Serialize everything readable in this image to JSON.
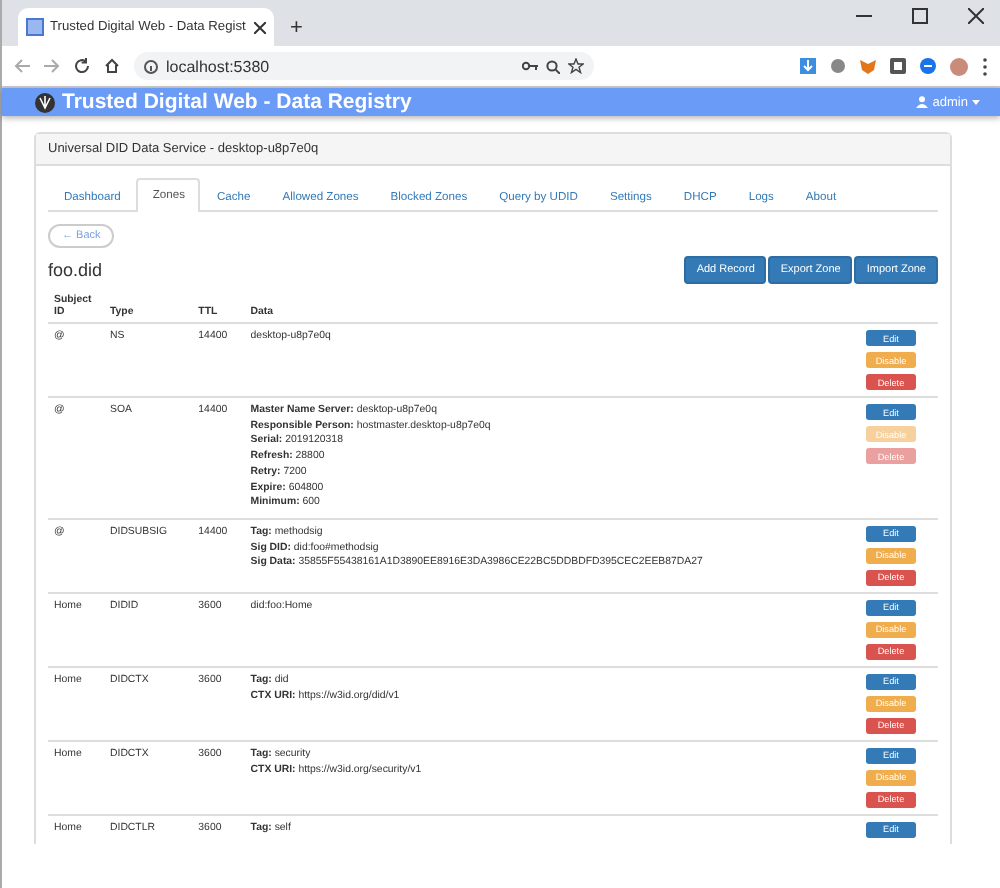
{
  "browser": {
    "tab_title": "Trusted Digital Web - Data Regist",
    "new_tab": "+",
    "address": "localhost:5380"
  },
  "app": {
    "title": "Trusted Digital Web - Data Registry",
    "user": "admin"
  },
  "panel": {
    "title": "Universal DID Data Service - desktop-u8p7e0q"
  },
  "tabs": [
    {
      "label": "Dashboard",
      "selected": false
    },
    {
      "label": "Zones",
      "selected": true
    },
    {
      "label": "Cache",
      "selected": false
    },
    {
      "label": "Allowed Zones",
      "selected": false
    },
    {
      "label": "Blocked Zones",
      "selected": false
    },
    {
      "label": "Query by UDID",
      "selected": false
    },
    {
      "label": "Settings",
      "selected": false
    },
    {
      "label": "DHCP",
      "selected": false
    },
    {
      "label": "Logs",
      "selected": false
    },
    {
      "label": "About",
      "selected": false
    }
  ],
  "back_button": "← Back",
  "zone": {
    "name": "foo.did",
    "buttons": [
      "Add Record",
      "Export Zone",
      "Import Zone"
    ]
  },
  "table": {
    "columns": [
      "Subject ID",
      "Type",
      "TTL",
      "Data"
    ],
    "rows": [
      {
        "subject": "@",
        "type": "NS",
        "ttl": "14400",
        "data": [
          "desktop-u8p7e0q"
        ],
        "actions": [
          {
            "label": "Edit",
            "kind": "edit",
            "disabled": false
          },
          {
            "label": "Disable",
            "kind": "disable",
            "disabled": false
          },
          {
            "label": "Delete",
            "kind": "delete",
            "disabled": false
          }
        ]
      },
      {
        "subject": "@",
        "type": "SOA",
        "ttl": "14400",
        "data": [
          "**Master Name Server:** desktop-u8p7e0q",
          "**Responsible Person:** hostmaster.desktop-u8p7e0q",
          "**Serial:** 2019120318",
          "**Refresh:** 28800",
          "**Retry:** 7200",
          "**Expire:** 604800",
          "**Minimum:** 600"
        ],
        "actions": [
          {
            "label": "Edit",
            "kind": "edit",
            "disabled": false
          },
          {
            "label": "Disable",
            "kind": "disable",
            "disabled": true
          },
          {
            "label": "Delete",
            "kind": "delete",
            "disabled": true
          }
        ]
      },
      {
        "subject": "@",
        "type": "DIDSUBSIG",
        "ttl": "14400",
        "data": [
          "**Tag:** methodsig",
          "**Sig DID:** did:foo#methodsig",
          "**Sig Data:** 35855F55438161A1D3890EE8916E3DA3986CE22BC5DDBDFD395CEC2EEB87DA27"
        ],
        "actions": [
          {
            "label": "Edit",
            "kind": "edit",
            "disabled": false
          },
          {
            "label": "Disable",
            "kind": "disable",
            "disabled": false
          },
          {
            "label": "Delete",
            "kind": "delete",
            "disabled": false
          }
        ]
      },
      {
        "subject": "Home",
        "type": "DIDID",
        "ttl": "3600",
        "data": [
          "did:foo:Home"
        ],
        "actions": [
          {
            "label": "Edit",
            "kind": "edit",
            "disabled": false
          },
          {
            "label": "Disable",
            "kind": "disable",
            "disabled": false
          },
          {
            "label": "Delete",
            "kind": "delete",
            "disabled": false
          }
        ]
      },
      {
        "subject": "Home",
        "type": "DIDCTX",
        "ttl": "3600",
        "data": [
          "**Tag:** did",
          "**CTX URI:** https://w3id.org/did/v1"
        ],
        "actions": [
          {
            "label": "Edit",
            "kind": "edit",
            "disabled": false
          },
          {
            "label": "Disable",
            "kind": "disable",
            "disabled": false
          },
          {
            "label": "Delete",
            "kind": "delete",
            "disabled": false
          }
        ]
      },
      {
        "subject": "Home",
        "type": "DIDCTX",
        "ttl": "3600",
        "data": [
          "**Tag:** security",
          "**CTX URI:** https://w3id.org/security/v1"
        ],
        "actions": [
          {
            "label": "Edit",
            "kind": "edit",
            "disabled": false
          },
          {
            "label": "Disable",
            "kind": "disable",
            "disabled": false
          },
          {
            "label": "Delete",
            "kind": "delete",
            "disabled": false
          }
        ]
      },
      {
        "subject": "Home",
        "type": "DIDCTLR",
        "ttl": "3600",
        "data": [
          "**Tag:** self"
        ],
        "actions": [
          {
            "label": "Edit",
            "kind": "edit",
            "disabled": false
          }
        ]
      }
    ]
  }
}
